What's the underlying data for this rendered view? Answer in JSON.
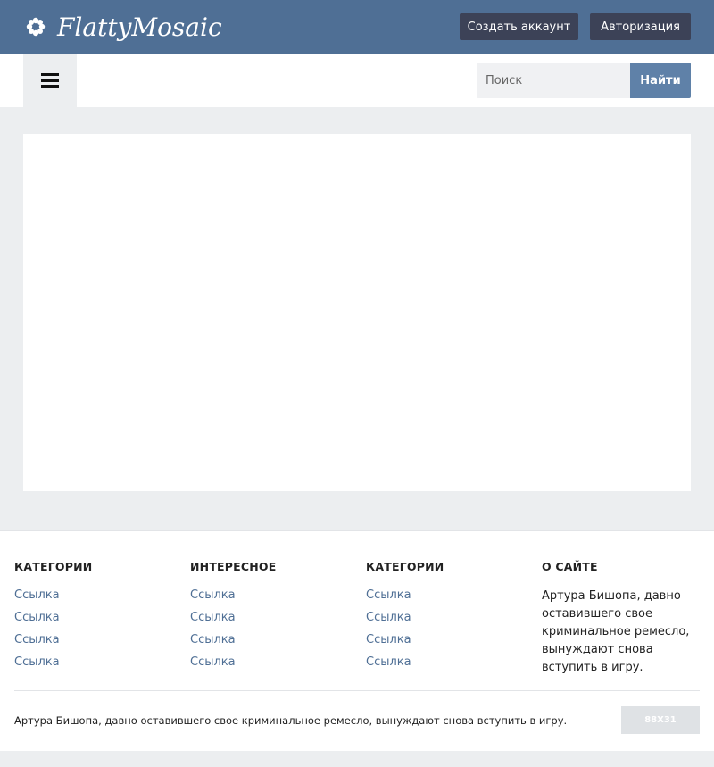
{
  "header": {
    "logo_text": "FlattyMosaic",
    "logo_icon": "flower-icon",
    "register_label": "Создать аккаунт",
    "login_label": "Авторизация",
    "brand_color": "#4f6f95"
  },
  "nav": {
    "menu_icon": "hamburger-icon",
    "search_placeholder": "Поиск",
    "search_button": "Найти"
  },
  "footer": {
    "columns": [
      {
        "title": "КАТЕГОРИИ",
        "links": [
          "Ссылка",
          "Ссылка",
          "Ссылка",
          "Ссылка"
        ]
      },
      {
        "title": "ИНТЕРЕСНОЕ",
        "links": [
          "Ссылка",
          "Ссылка",
          "Ссылка",
          "Ссылка"
        ]
      },
      {
        "title": "КАТЕГОРИИ",
        "links": [
          "Ссылка",
          "Ссылка",
          "Ссылка",
          "Ссылка"
        ]
      }
    ],
    "about": {
      "title": "О САЙТЕ",
      "text": "Артура Бишопа, давно оставившего свое криминальное ремесло, вынуждают снова вступить в игру."
    },
    "copyright": "Артура Бишопа, давно оставившего свое криминальное ремесло, вынуждают снова вступить в игру.",
    "counter": "88X31"
  }
}
